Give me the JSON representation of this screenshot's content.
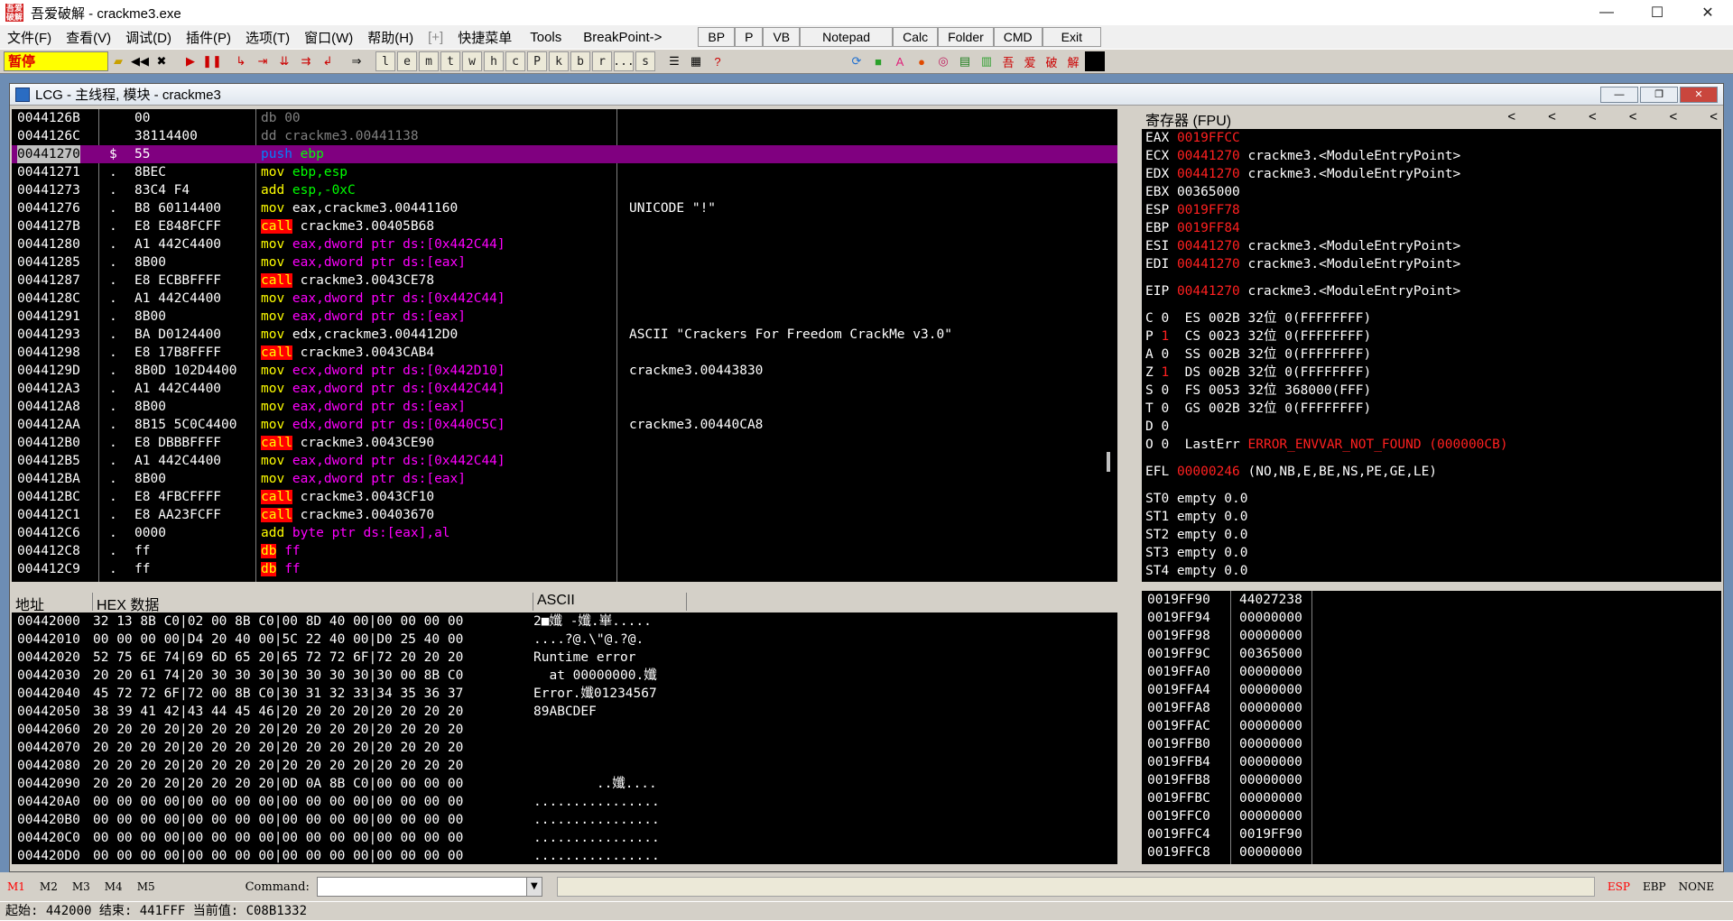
{
  "window": {
    "title": "吾爱破解 - crackme3.exe",
    "logo": "吾爱破解",
    "min": "—",
    "max": "☐",
    "close": "✕"
  },
  "menu": [
    "文件(F)",
    "查看(V)",
    "调试(D)",
    "插件(P)",
    "选项(T)",
    "窗口(W)",
    "帮助(H)",
    "[+]",
    "快捷菜单",
    "Tools",
    "BreakPoint->"
  ],
  "menu_buttons": [
    "BP",
    "P",
    "VB",
    "Notepad",
    "Calc",
    "Folder",
    "CMD",
    "Exit"
  ],
  "toolbar": {
    "status": "暂停",
    "letters": [
      "l",
      "e",
      "m",
      "t",
      "w",
      "h",
      "c",
      "P",
      "k",
      "b",
      "r",
      "...",
      "s"
    ]
  },
  "child": {
    "title": "LCG - 主线程, 模块 - crackme3",
    "btn_min": "—",
    "btn_max": "❐",
    "btn_close": "✕"
  },
  "disasm": [
    {
      "addr": "0044126B",
      "mk": "",
      "hex": "00",
      "mn": "db",
      "op": " 00",
      "cmt": "",
      "k": "dd"
    },
    {
      "addr": "0044126C",
      "mk": "",
      "hex": "38114400",
      "mn": "dd",
      "op": " crackme3.00441138",
      "cmt": "",
      "k": "dd"
    },
    {
      "addr": "00441270",
      "mk": "$",
      "hex": "55",
      "mn": "push",
      "op": " ebp",
      "cmt": "",
      "k": "push",
      "hl": true
    },
    {
      "addr": "00441271",
      "mk": ".",
      "hex": "8BEC",
      "mn": "mov",
      "op": " ebp,esp",
      "cmt": "",
      "k": "mov",
      "o": "grn"
    },
    {
      "addr": "00441273",
      "mk": ".",
      "hex": "83C4 F4",
      "mn": "add",
      "op": " esp,-0xC",
      "cmt": "",
      "k": "add",
      "o": "grn"
    },
    {
      "addr": "00441276",
      "mk": ".",
      "hex": "B8 60114400",
      "mn": "mov",
      "op": " eax,crackme3.00441160",
      "cmt": "UNICODE \"!\"",
      "k": "mov",
      "o": "fff"
    },
    {
      "addr": "0044127B",
      "mk": ".",
      "hex": "E8 E848FCFF",
      "mn": "call",
      "op": " crackme3.00405B68",
      "cmt": "",
      "k": "call",
      "o": "fff"
    },
    {
      "addr": "00441280",
      "mk": ".",
      "hex": "A1 442C4400",
      "mn": "mov",
      "op": " eax,dword ptr ds:[0x442C44]",
      "cmt": "",
      "k": "mov",
      "o": "mag"
    },
    {
      "addr": "00441285",
      "mk": ".",
      "hex": "8B00",
      "mn": "mov",
      "op": " eax,dword ptr ds:[eax]",
      "cmt": "",
      "k": "mov",
      "o": "mag"
    },
    {
      "addr": "00441287",
      "mk": ".",
      "hex": "E8 ECBBFFFF",
      "mn": "call",
      "op": " crackme3.0043CE78",
      "cmt": "",
      "k": "call",
      "o": "fff"
    },
    {
      "addr": "0044128C",
      "mk": ".",
      "hex": "A1 442C4400",
      "mn": "mov",
      "op": " eax,dword ptr ds:[0x442C44]",
      "cmt": "",
      "k": "mov",
      "o": "mag"
    },
    {
      "addr": "00441291",
      "mk": ".",
      "hex": "8B00",
      "mn": "mov",
      "op": " eax,dword ptr ds:[eax]",
      "cmt": "",
      "k": "mov",
      "o": "mag"
    },
    {
      "addr": "00441293",
      "mk": ".",
      "hex": "BA D0124400",
      "mn": "mov",
      "op": " edx,crackme3.004412D0",
      "cmt": "ASCII \"Crackers For Freedom CrackMe v3.0\"",
      "k": "mov",
      "o": "fff"
    },
    {
      "addr": "00441298",
      "mk": ".",
      "hex": "E8 17B8FFFF",
      "mn": "call",
      "op": " crackme3.0043CAB4",
      "cmt": "",
      "k": "call",
      "o": "fff"
    },
    {
      "addr": "0044129D",
      "mk": ".",
      "hex": "8B0D 102D4400",
      "mn": "mov",
      "op": " ecx,dword ptr ds:[0x442D10]",
      "cmt": "crackme3.00443830",
      "k": "mov",
      "o": "mag"
    },
    {
      "addr": "004412A3",
      "mk": ".",
      "hex": "A1 442C4400",
      "mn": "mov",
      "op": " eax,dword ptr ds:[0x442C44]",
      "cmt": "",
      "k": "mov",
      "o": "mag"
    },
    {
      "addr": "004412A8",
      "mk": ".",
      "hex": "8B00",
      "mn": "mov",
      "op": " eax,dword ptr ds:[eax]",
      "cmt": "",
      "k": "mov",
      "o": "mag"
    },
    {
      "addr": "004412AA",
      "mk": ".",
      "hex": "8B15 5C0C4400",
      "mn": "mov",
      "op": " edx,dword ptr ds:[0x440C5C]",
      "cmt": "crackme3.00440CA8",
      "k": "mov",
      "o": "mag"
    },
    {
      "addr": "004412B0",
      "mk": ".",
      "hex": "E8 DBBBFFFF",
      "mn": "call",
      "op": " crackme3.0043CE90",
      "cmt": "",
      "k": "call",
      "o": "fff"
    },
    {
      "addr": "004412B5",
      "mk": ".",
      "hex": "A1 442C4400",
      "mn": "mov",
      "op": " eax,dword ptr ds:[0x442C44]",
      "cmt": "",
      "k": "mov",
      "o": "mag"
    },
    {
      "addr": "004412BA",
      "mk": ".",
      "hex": "8B00",
      "mn": "mov",
      "op": " eax,dword ptr ds:[eax]",
      "cmt": "",
      "k": "mov",
      "o": "mag"
    },
    {
      "addr": "004412BC",
      "mk": ".",
      "hex": "E8 4FBCFFFF",
      "mn": "call",
      "op": " crackme3.0043CF10",
      "cmt": "",
      "k": "call",
      "o": "fff"
    },
    {
      "addr": "004412C1",
      "mk": ".",
      "hex": "E8 AA23FCFF",
      "mn": "call",
      "op": " crackme3.00403670",
      "cmt": "",
      "k": "call",
      "o": "fff"
    },
    {
      "addr": "004412C6",
      "mk": ".",
      "hex": "0000",
      "mn": "add",
      "op": " byte ptr ds:[eax],al",
      "cmt": "",
      "k": "add",
      "o": "mag"
    },
    {
      "addr": "004412C8",
      "mk": ".",
      "hex": "ff",
      "mn": "db",
      "op": " ff",
      "cmt": "",
      "k": "db",
      "o": "mag"
    },
    {
      "addr": "004412C9",
      "mk": ".",
      "hex": "ff",
      "mn": "db",
      "op": " ff",
      "cmt": "",
      "k": "db",
      "o": "mag"
    }
  ],
  "regs": {
    "header": "寄存器 (FPU)",
    "arrows": [
      "<",
      "<",
      "<",
      "<",
      "<",
      "<"
    ],
    "lines": [
      {
        "n": "EAX",
        "v": "0019FFCC",
        "c": "",
        "red": true
      },
      {
        "n": "ECX",
        "v": "00441270",
        "c": "crackme3.<ModuleEntryPoint>",
        "red": true
      },
      {
        "n": "EDX",
        "v": "00441270",
        "c": "crackme3.<ModuleEntryPoint>",
        "red": true
      },
      {
        "n": "EBX",
        "v": "00365000",
        "c": "",
        "red": false
      },
      {
        "n": "ESP",
        "v": "0019FF78",
        "c": "",
        "red": true
      },
      {
        "n": "EBP",
        "v": "0019FF84",
        "c": "",
        "red": true
      },
      {
        "n": "ESI",
        "v": "00441270",
        "c": "crackme3.<ModuleEntryPoint>",
        "red": true
      },
      {
        "n": "EDI",
        "v": "00441270",
        "c": "crackme3.<ModuleEntryPoint>",
        "red": true
      }
    ],
    "eip": {
      "n": "EIP",
      "v": "00441270",
      "c": "crackme3.<ModuleEntryPoint>"
    },
    "flags": [
      {
        "f": "C",
        "v": "0",
        "s": "ES 002B 32位 0(FFFFFFFF)",
        "red": false
      },
      {
        "f": "P",
        "v": "1",
        "s": "CS 0023 32位 0(FFFFFFFF)",
        "red": true
      },
      {
        "f": "A",
        "v": "0",
        "s": "SS 002B 32位 0(FFFFFFFF)",
        "red": false
      },
      {
        "f": "Z",
        "v": "1",
        "s": "DS 002B 32位 0(FFFFFFFF)",
        "red": true
      },
      {
        "f": "S",
        "v": "0",
        "s": "FS 0053 32位 368000(FFF)",
        "red": false
      },
      {
        "f": "T",
        "v": "0",
        "s": "GS 002B 32位 0(FFFFFFFF)",
        "red": false
      },
      {
        "f": "D",
        "v": "0",
        "s": "",
        "red": false
      }
    ],
    "lasterr": {
      "f": "O",
      "v": "0",
      "label": "LastErr",
      "val": "ERROR_ENVVAR_NOT_FOUND (000000CB)"
    },
    "efl": {
      "n": "EFL",
      "v": "00000246",
      "c": "(NO,NB,E,BE,NS,PE,GE,LE)"
    },
    "st": [
      "ST0 empty 0.0",
      "ST1 empty 0.0",
      "ST2 empty 0.0",
      "ST3 empty 0.0",
      "ST4 empty 0.0"
    ]
  },
  "dump": {
    "headers": [
      "地址",
      "HEX 数据",
      "ASCII"
    ],
    "rows": [
      {
        "a": "00442000",
        "h": "32 13 8B C0|02 00 8B C0|00 8D 40 00|00 00 00 00",
        "s": "2■孅 -孅.崋....."
      },
      {
        "a": "00442010",
        "h": "00 00 00 00|D4 20 40 00|5C 22 40 00|D0 25 40 00",
        "s": "....?@.\\\"@.?@."
      },
      {
        "a": "00442020",
        "h": "52 75 6E 74|69 6D 65 20|65 72 72 6F|72 20 20 20",
        "s": "Runtime error"
      },
      {
        "a": "00442030",
        "h": "20 20 61 74|20 30 30 30|30 30 30 30|30 00 8B C0",
        "s": "  at 00000000.孅"
      },
      {
        "a": "00442040",
        "h": "45 72 72 6F|72 00 8B C0|30 31 32 33|34 35 36 37",
        "s": "Error.孅01234567"
      },
      {
        "a": "00442050",
        "h": "38 39 41 42|43 44 45 46|20 20 20 20|20 20 20 20",
        "s": "89ABCDEF"
      },
      {
        "a": "00442060",
        "h": "20 20 20 20|20 20 20 20|20 20 20 20|20 20 20 20",
        "s": ""
      },
      {
        "a": "00442070",
        "h": "20 20 20 20|20 20 20 20|20 20 20 20|20 20 20 20",
        "s": ""
      },
      {
        "a": "00442080",
        "h": "20 20 20 20|20 20 20 20|20 20 20 20|20 20 20 20",
        "s": ""
      },
      {
        "a": "00442090",
        "h": "20 20 20 20|20 20 20 20|0D 0A 8B C0|00 00 00 00",
        "s": "        ..孅...."
      },
      {
        "a": "004420A0",
        "h": "00 00 00 00|00 00 00 00|00 00 00 00|00 00 00 00",
        "s": "................"
      },
      {
        "a": "004420B0",
        "h": "00 00 00 00|00 00 00 00|00 00 00 00|00 00 00 00",
        "s": "................"
      },
      {
        "a": "004420C0",
        "h": "00 00 00 00|00 00 00 00|00 00 00 00|00 00 00 00",
        "s": "................"
      },
      {
        "a": "004420D0",
        "h": "00 00 00 00|00 00 00 00|00 00 00 00|00 00 00 00",
        "s": "................"
      }
    ]
  },
  "stack": [
    {
      "a": "0019FF90",
      "v": "44027238"
    },
    {
      "a": "0019FF94",
      "v": "00000000"
    },
    {
      "a": "0019FF98",
      "v": "00000000"
    },
    {
      "a": "0019FF9C",
      "v": "00365000"
    },
    {
      "a": "0019FFA0",
      "v": "00000000"
    },
    {
      "a": "0019FFA4",
      "v": "00000000"
    },
    {
      "a": "0019FFA8",
      "v": "00000000"
    },
    {
      "a": "0019FFAC",
      "v": "00000000"
    },
    {
      "a": "0019FFB0",
      "v": "00000000"
    },
    {
      "a": "0019FFB4",
      "v": "00000000"
    },
    {
      "a": "0019FFB8",
      "v": "00000000"
    },
    {
      "a": "0019FFBC",
      "v": "00000000"
    },
    {
      "a": "0019FFC0",
      "v": "00000000"
    },
    {
      "a": "0019FFC4",
      "v": "0019FF90"
    },
    {
      "a": "0019FFC8",
      "v": "00000000"
    }
  ],
  "bottom": {
    "m": [
      "M1",
      "M2",
      "M3",
      "M4",
      "M5"
    ],
    "cmd_label": "Command:",
    "right": [
      "ESP",
      "EBP",
      "NONE"
    ]
  },
  "status": "起始: 442000 结束: 441FFF 当前值: C08B1332"
}
